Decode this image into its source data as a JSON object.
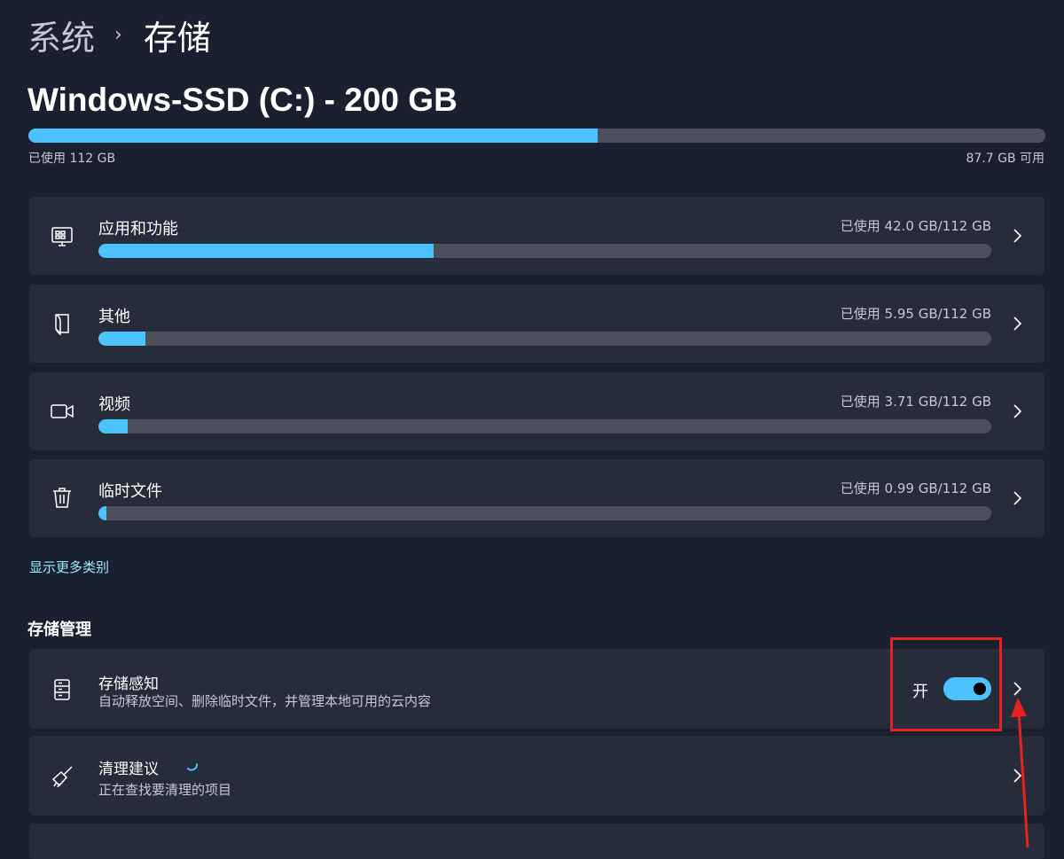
{
  "breadcrumb": {
    "parent": "系统",
    "separator": "›",
    "current": "存储"
  },
  "drive": {
    "title": "Windows-SSD (C:) - 200 GB",
    "used_label": "已使用 112 GB",
    "free_label": "87.7 GB 可用",
    "used_fraction": 0.56
  },
  "categories": [
    {
      "label": "应用和功能",
      "usage": "已使用 42.0 GB/112 GB",
      "fraction": 0.375,
      "icon": "apps-features-icon"
    },
    {
      "label": "其他",
      "usage": "已使用 5.95 GB/112 GB",
      "fraction": 0.053,
      "icon": "document-icon"
    },
    {
      "label": "视频",
      "usage": "已使用 3.71 GB/112 GB",
      "fraction": 0.033,
      "icon": "video-camera-icon"
    },
    {
      "label": "临时文件",
      "usage": "已使用 0.99 GB/112 GB",
      "fraction": 0.009,
      "icon": "trash-icon"
    }
  ],
  "show_more": "显示更多类别",
  "management": {
    "title": "存储管理",
    "storage_sense": {
      "title": "存储感知",
      "subtitle": "自动释放空间、删除临时文件，并管理本地可用的云内容",
      "toggle_label": "开",
      "toggle_on": true,
      "icon": "storage-drive-icon"
    },
    "cleanup": {
      "title": "清理建议",
      "subtitle": "正在查找要清理的项目",
      "icon": "broom-icon"
    }
  },
  "colors": {
    "accent": "#4cc2ff",
    "background": "#1b2030",
    "card": "#272c3b",
    "track": "#4b505c",
    "annotation": "#e8221d",
    "link": "#99ebff"
  }
}
